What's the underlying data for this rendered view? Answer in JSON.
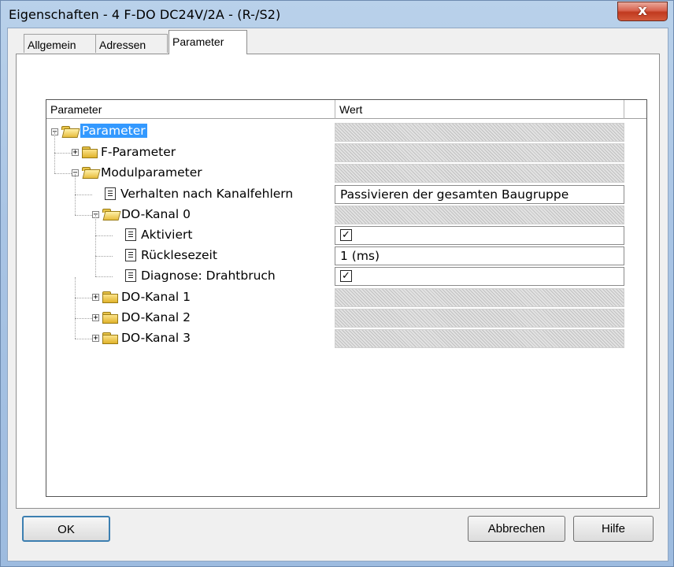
{
  "window": {
    "title": "Eigenschaften - 4 F-DO DC24V/2A - (R-/S2)",
    "close_label": "x"
  },
  "tabs": [
    {
      "label": "Allgemein"
    },
    {
      "label": "Adressen"
    },
    {
      "label": "Parameter",
      "active": true
    }
  ],
  "grid": {
    "columns": [
      "Parameter",
      "Wert"
    ],
    "rows": [
      {
        "name": "Parameter",
        "value": "",
        "icon": "folder-open-icon",
        "expander": "−",
        "selected": true
      },
      {
        "name": "F-Parameter",
        "value": "",
        "icon": "folder-icon",
        "expander": "+"
      },
      {
        "name": "Modulparameter",
        "value": "",
        "icon": "folder-open-icon",
        "expander": "−"
      },
      {
        "name": "Verhalten nach Kanalfehlern",
        "value": "Passivieren der gesamten Baugruppe",
        "icon": "parameter-doc-icon"
      },
      {
        "name": "DO-Kanal 0",
        "value": "",
        "icon": "folder-open-icon",
        "expander": "−"
      },
      {
        "name": "Aktiviert",
        "value": "",
        "checked": true,
        "icon": "parameter-doc-icon"
      },
      {
        "name": "Rücklesezeit",
        "value": "1 (ms)",
        "icon": "parameter-doc-icon"
      },
      {
        "name": "Diagnose: Drahtbruch",
        "value": "",
        "checked": true,
        "icon": "parameter-doc-icon"
      },
      {
        "name": "DO-Kanal 1",
        "value": "",
        "icon": "folder-icon",
        "expander": "+"
      },
      {
        "name": "DO-Kanal 2",
        "value": "",
        "icon": "folder-icon",
        "expander": "+"
      },
      {
        "name": "DO-Kanal 3",
        "value": "",
        "icon": "folder-icon",
        "expander": "+"
      }
    ]
  },
  "buttons": {
    "ok": "OK",
    "cancel": "Abbrechen",
    "help": "Hilfe"
  },
  "colors": {
    "selection": "#3399ff",
    "close": "#c0391f"
  }
}
